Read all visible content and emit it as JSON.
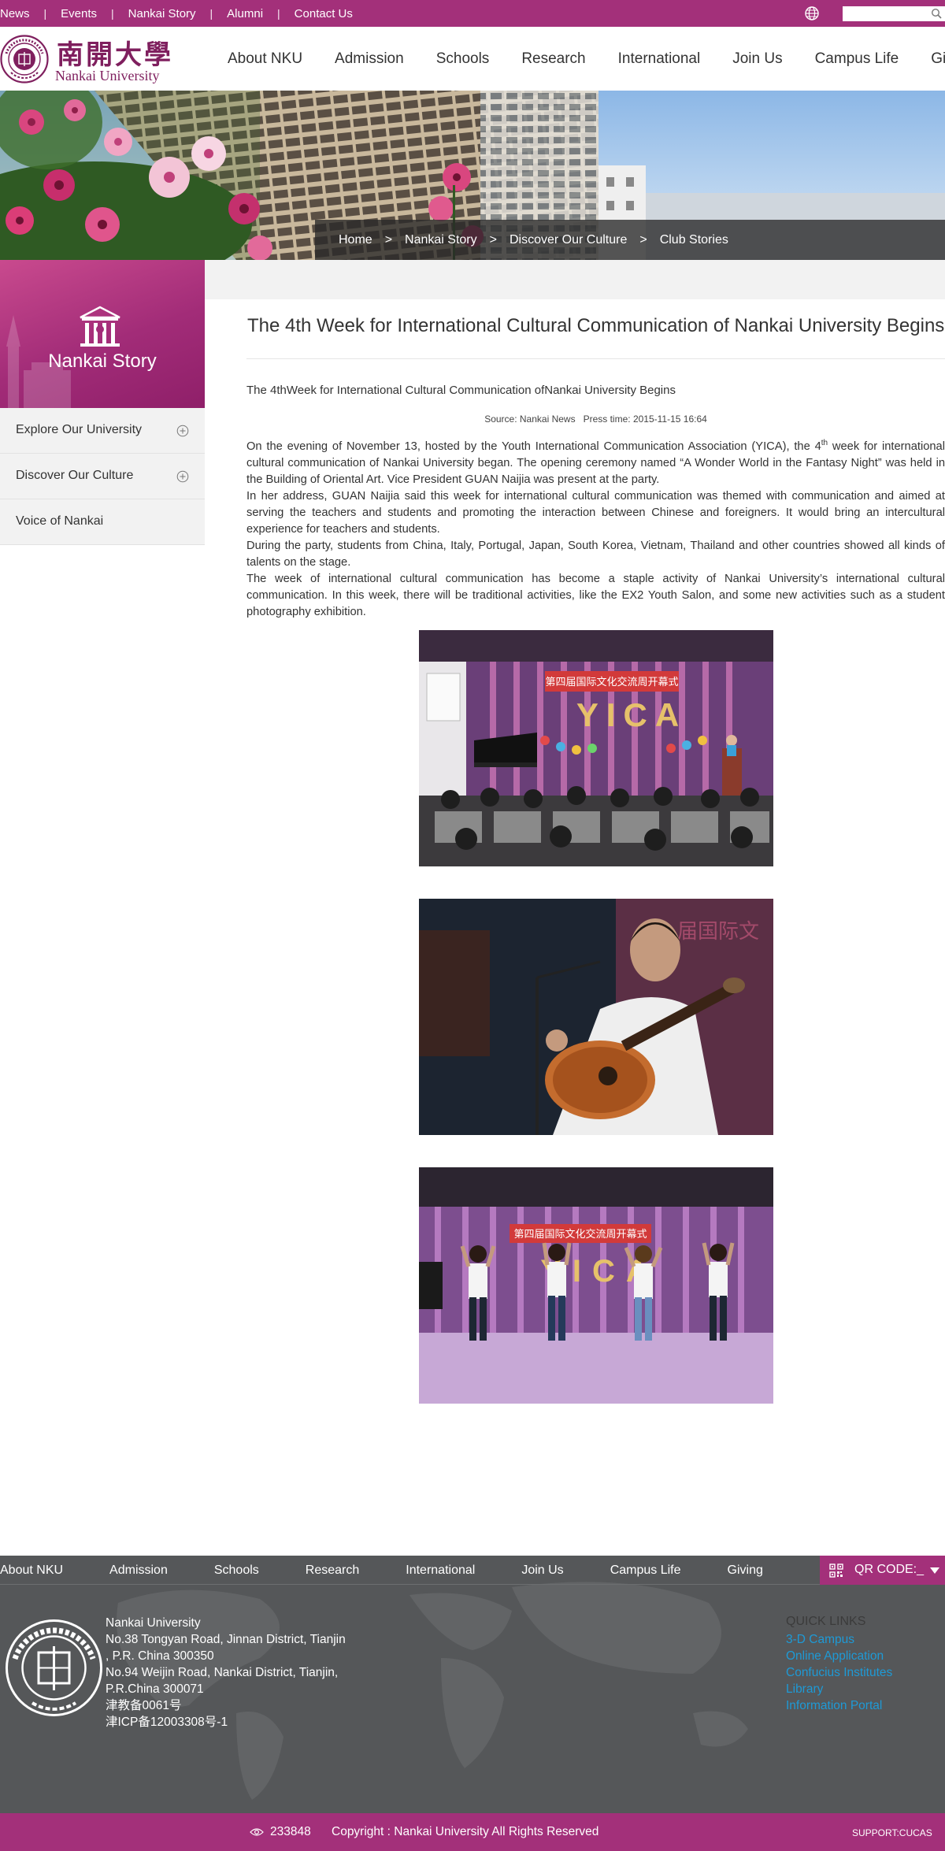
{
  "topbar": {
    "links": [
      "News",
      "Events",
      "Nankai Story",
      "Alumni",
      "Contact Us"
    ],
    "search_placeholder": ""
  },
  "header": {
    "logo_cn": "南開大學",
    "logo_en": "Nankai University",
    "nav": [
      "About NKU",
      "Admission",
      "Schools",
      "Research",
      "International",
      "Join Us",
      "Campus Life",
      "Giving"
    ]
  },
  "breadcrumb": [
    "Home",
    "Nankai Story",
    "Discover Our Culture",
    "Club Stories"
  ],
  "breadcrumb_separator": ">",
  "sidebar": {
    "title": "Nankai Story",
    "items": [
      {
        "label": "Explore Our University",
        "expandable": true
      },
      {
        "label": "Discover Our Culture",
        "expandable": true
      },
      {
        "label": "Voice of Nankai",
        "expandable": false
      }
    ]
  },
  "article": {
    "title": "The 4th Week for International Cultural Communication of Nankai University Begins",
    "subtitle": "The 4thWeek for International Cultural Communication ofNankai University Begins",
    "source": "Source: Nankai News",
    "press_time": "Press time: 2015-11-15 16:64",
    "p1_before": "On the evening of November 13, hosted by the Youth International Communication Association (YICA), the 4",
    "p1_sup": "th",
    "p1_after": " week for international cultural communication of Nankai University began. The opening ceremony named “A Wonder World in the Fantasy Night” was held in the Building of Oriental Art. Vice President GUAN Naijia was present at the party.",
    "p2": "In her address, GUAN Naijia said this week for international cultural communication was themed with communication and aimed at serving the teachers and students and promoting the interaction between Chinese and foreigners. It would bring an intercultural experience for teachers and students.",
    "p3": "During the party, students from China, Italy, Portugal, Japan, South Korea, Vietnam, Thailand and other countries showed all kinds of talents on the stage.",
    "p4": "The week of international cultural communication has become a staple activity of Nankai University’s international cultural communication. In this week, there will be traditional activities, like the EX2 Youth Salon, and some new activities such as a student photography exhibition.",
    "photos": [
      {
        "banner_text": "第四届国际文化交流周开幕式",
        "stage_letters": "YICA"
      },
      {
        "banner_text": "届国际文",
        "stage_letters": ""
      },
      {
        "banner_text": "第四届国际文化交流周开幕式",
        "stage_letters": "YICA"
      }
    ]
  },
  "footer": {
    "nav": [
      "About NKU",
      "Admission",
      "Schools",
      "Research",
      "International",
      "Join Us",
      "Campus Life",
      "Giving"
    ],
    "qr_label": "QR CODE:_",
    "address_lines": [
      "Nankai University",
      "No.38 Tongyan Road, Jinnan District, Tianjin",
      ", P.R. China 300350",
      "No.94 Weijin Road,  Nankai District, Tianjin,",
      "P.R.China  300071",
      "津教备0061号",
      "津ICP备12003308号-1"
    ],
    "quick_links_title": "QUICK LINKS",
    "quick_links": [
      "3-D Campus",
      "Online Application",
      "Confucius Institutes",
      "Library",
      "Information Portal"
    ],
    "visits": "233848",
    "copyright": "Copyright : Nankai University All Rights Reserved",
    "support": "SUPPORT:CUCAS"
  },
  "colors": {
    "brand": "#a3307a",
    "footer_bg": "#555759",
    "link": "#1e9ad6"
  }
}
